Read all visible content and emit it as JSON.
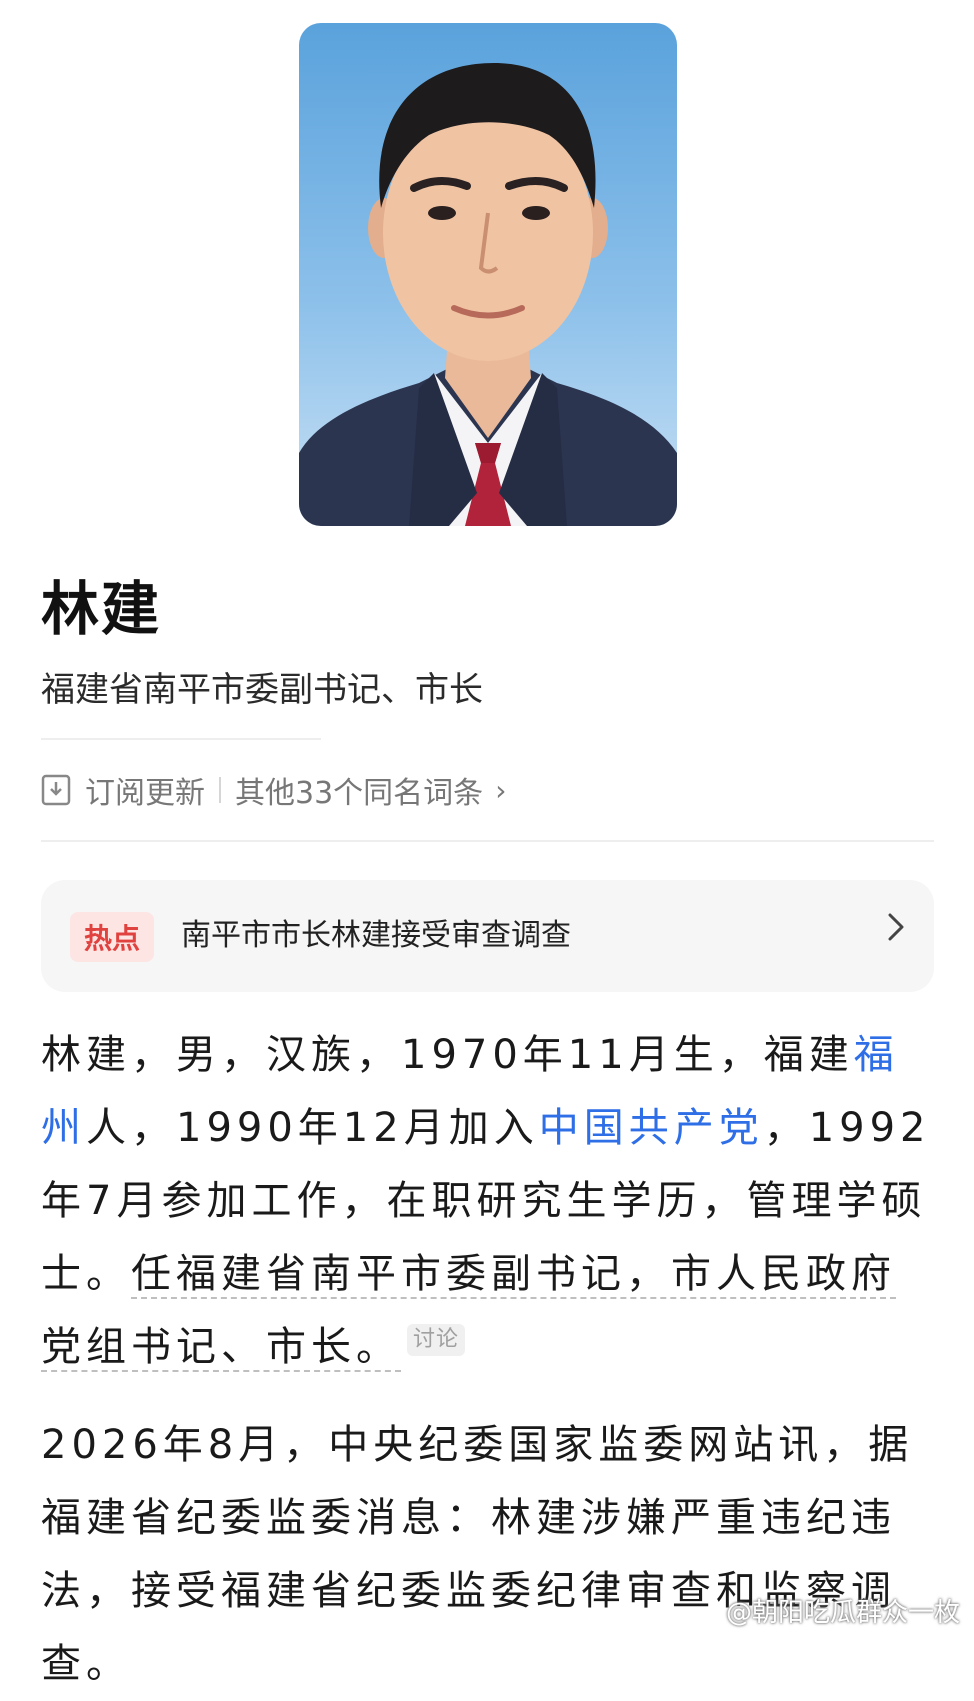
{
  "profile": {
    "name": "林建",
    "title": "福建省南平市委副书记、市长",
    "subscribe_label": "订阅更新",
    "same_name_label": "其他33个同名词条",
    "chevron": "›"
  },
  "hot": {
    "badge": "热点",
    "text": "南平市市长林建接受审查调查"
  },
  "bio": {
    "s1": "林建，男，汉族，1970年11月生，福建",
    "link1": "福州",
    "s2": "人，1990年12月加入",
    "link2": "中国共产党",
    "s3": "，1992年7月参加工作，在职研究生学历，管理学硕士。",
    "s4": "任福建省南平市委副书记，市人民政府党组书记、市长。",
    "discuss": "讨论"
  },
  "news": {
    "text": "2026年8月，中央纪委国家监委网站讯，据福建省纪委监委消息：林建涉嫌严重违纪违法，接受福建省纪委监委纪律审查和监察调查。"
  },
  "watermark": "@朝阳吃瓜群众一枚",
  "colors": {
    "link": "#2e6ee6",
    "hot_badge_bg": "#fde5e4",
    "hot_badge_text": "#e0433f",
    "card_bg": "#f6f6f6"
  },
  "icons": [
    "subscribe-icon",
    "chevron-right-icon"
  ]
}
